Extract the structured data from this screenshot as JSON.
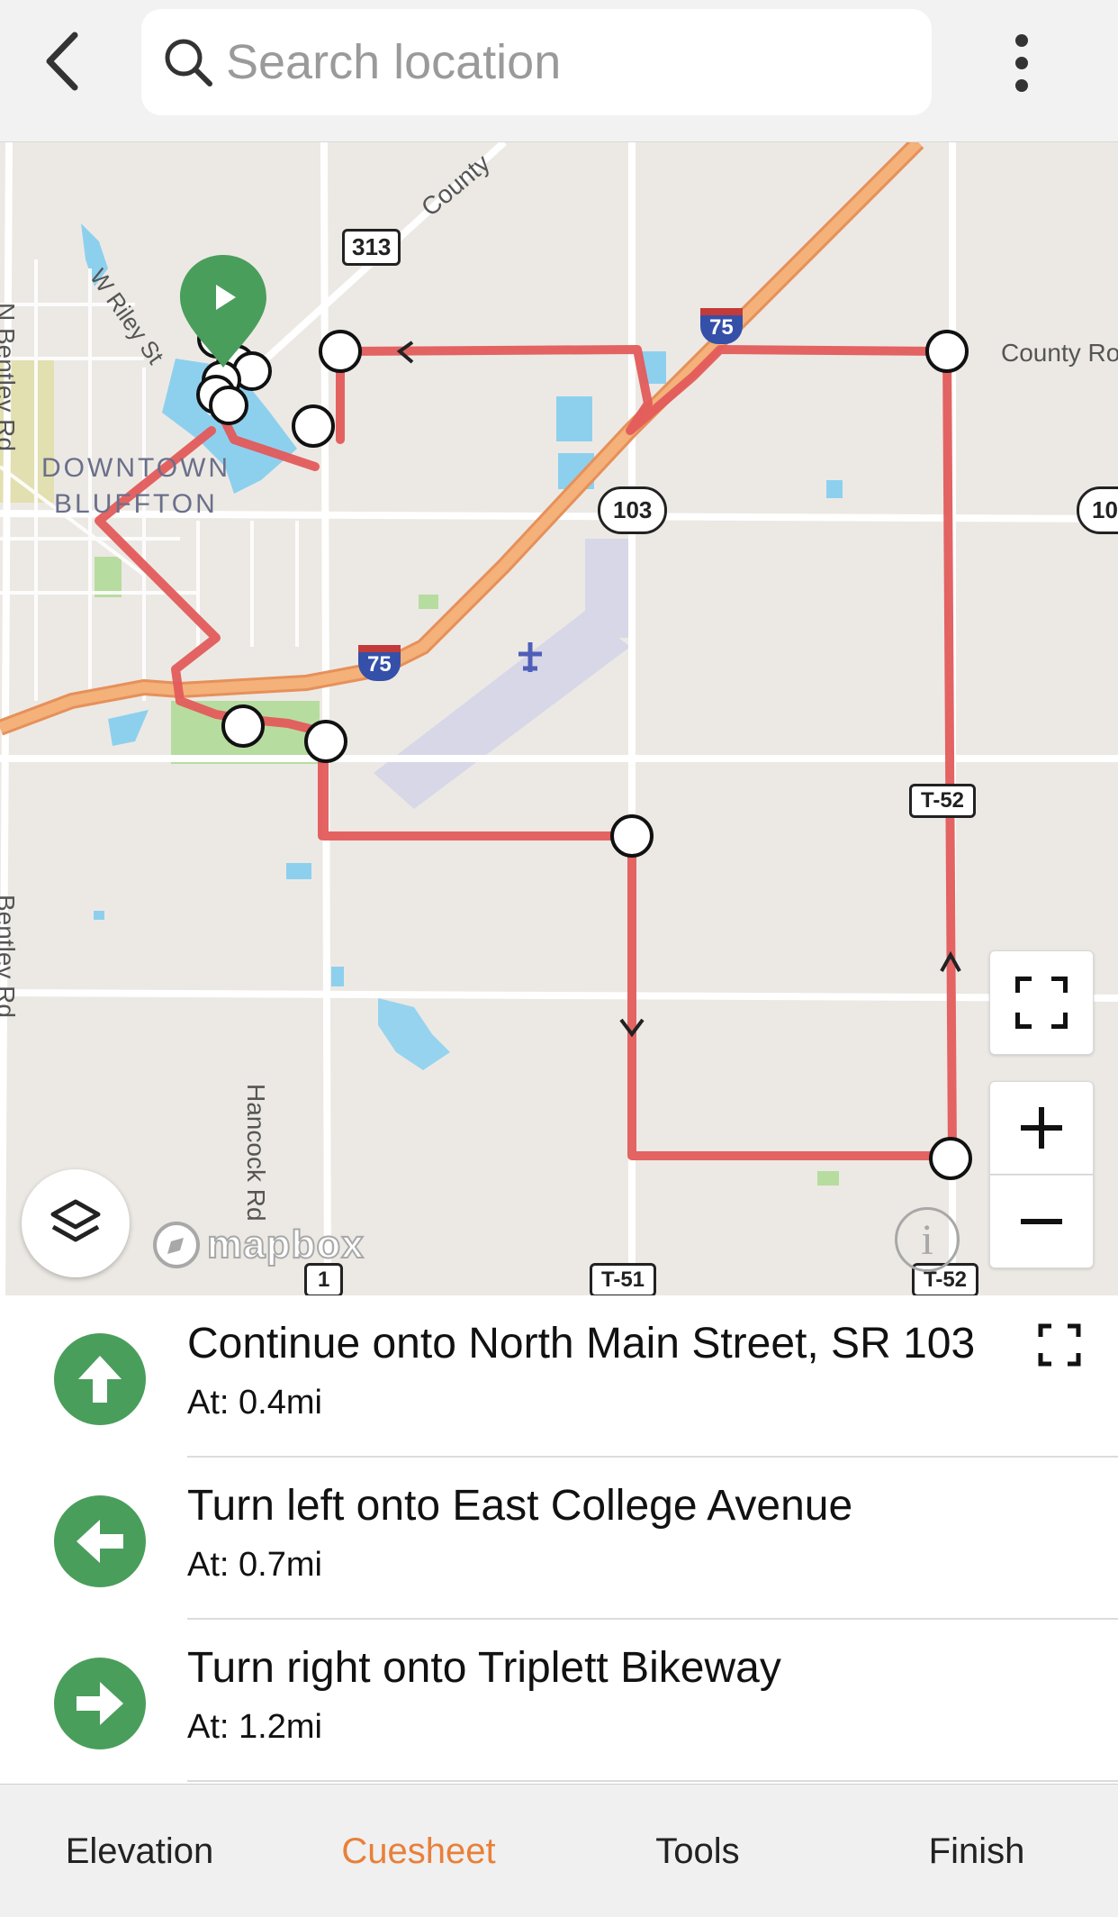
{
  "header": {
    "back_icon": "chevron-left-icon",
    "search_placeholder": "Search location",
    "search_value": "",
    "more_icon": "more-vertical-icon"
  },
  "map": {
    "labels": {
      "county_road_top": "County",
      "county_road_right": "County Ro",
      "w_riley": "W Riley St",
      "downtown_line1": "DOWNTOWN",
      "downtown_line2": "BLUFFTON",
      "hancock": "Hancock Rd",
      "bentley_left": "Bentley Rd",
      "n_bentley": "N Bentley Rd"
    },
    "shields": {
      "r313": "313",
      "i75_top": "75",
      "i75_mid": "75",
      "r103": "103",
      "r103_right": "10",
      "t52_mid": "T-52",
      "t51": "T-51",
      "t52_bottom": "T-52",
      "r1": "1"
    },
    "attribution": "mapbox",
    "colors": {
      "route": "#e35b5b",
      "interstate": "#f0a35e",
      "water": "#8dd0ee",
      "park": "#b7dca0",
      "land": "#ece9e4",
      "roads": "#ffffff",
      "start_marker": "#4a9e5c"
    }
  },
  "cues": [
    {
      "direction": "straight",
      "icon": "arrow-up-icon",
      "title": "Continue onto North Main Street, SR 103",
      "distance": "At: 0.4mi"
    },
    {
      "direction": "left",
      "icon": "arrow-left-icon",
      "title": "Turn left onto East College Avenue",
      "distance": "At: 0.7mi"
    },
    {
      "direction": "right",
      "icon": "arrow-right-icon",
      "title": "Turn right onto Triplett Bikeway",
      "distance": "At: 1.2mi"
    }
  ],
  "tabs": [
    {
      "label": "Elevation",
      "active": false
    },
    {
      "label": "Cuesheet",
      "active": true
    },
    {
      "label": "Tools",
      "active": false
    },
    {
      "label": "Finish",
      "active": false
    }
  ],
  "accent_color": "#e8803a"
}
